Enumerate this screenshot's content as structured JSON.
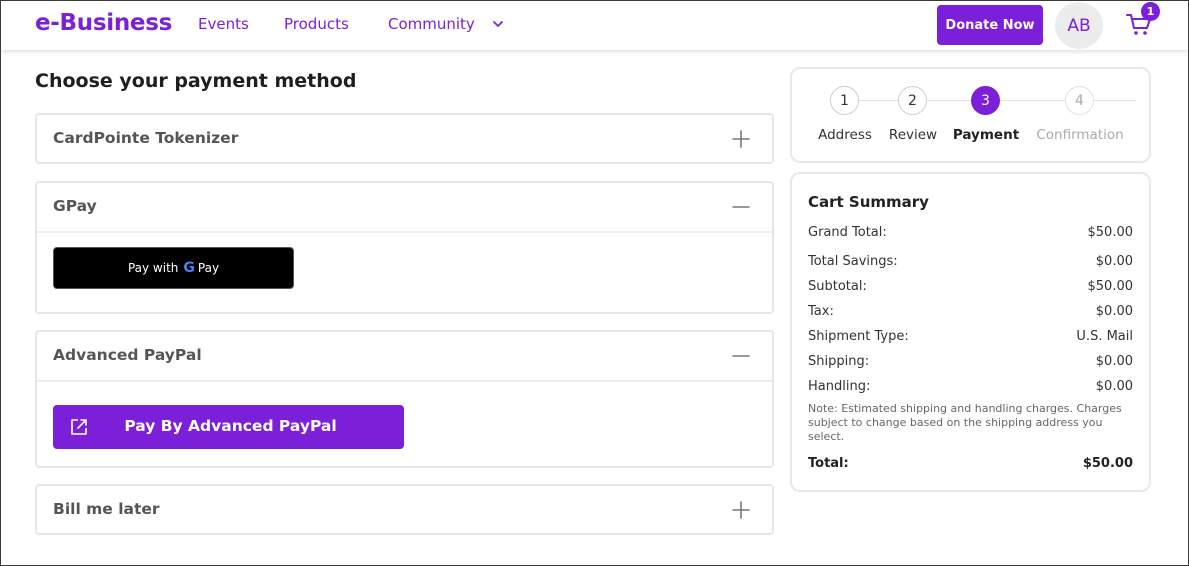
{
  "header": {
    "logo": "e-Business",
    "nav": [
      {
        "label": "Events"
      },
      {
        "label": "Products"
      },
      {
        "label": "Community"
      }
    ],
    "donate_label": "Donate Now",
    "avatar_initials": "AB",
    "cart_count": "1",
    "accent_color": "#7b1fd8"
  },
  "main": {
    "title": "Choose your payment method",
    "panels": [
      {
        "title": "CardPointe Tokenizer",
        "state": "collapsed"
      },
      {
        "title": "GPay",
        "state": "expanded",
        "button_text": "Pay with",
        "button_brand": "Pay"
      },
      {
        "title": "Advanced PayPal",
        "state": "expanded",
        "button_label": "Pay By Advanced PayPal"
      },
      {
        "title": "Bill me later",
        "state": "collapsed"
      }
    ]
  },
  "stepper": {
    "steps": [
      {
        "number": "1",
        "label": "Address",
        "status": "done"
      },
      {
        "number": "2",
        "label": "Review",
        "status": "done"
      },
      {
        "number": "3",
        "label": "Payment",
        "status": "active"
      },
      {
        "number": "4",
        "label": "Confirmation",
        "status": "future"
      }
    ]
  },
  "cart_summary": {
    "title": "Cart Summary",
    "rows": [
      {
        "label": "Grand Total:",
        "value": "$50.00"
      },
      {
        "label": "Total Savings:",
        "value": "$0.00"
      },
      {
        "label": "Subtotal:",
        "value": "$50.00"
      },
      {
        "label": "Tax:",
        "value": "$0.00"
      },
      {
        "label": "Shipment Type:",
        "value": "U.S. Mail"
      },
      {
        "label": "Shipping:",
        "value": "$0.00"
      },
      {
        "label": "Handling:",
        "value": "$0.00"
      }
    ],
    "note": "Note: Estimated shipping and handling charges. Charges subject to change based on the shipping address you select.",
    "total_label": "Total:",
    "total_value": "$50.00"
  }
}
